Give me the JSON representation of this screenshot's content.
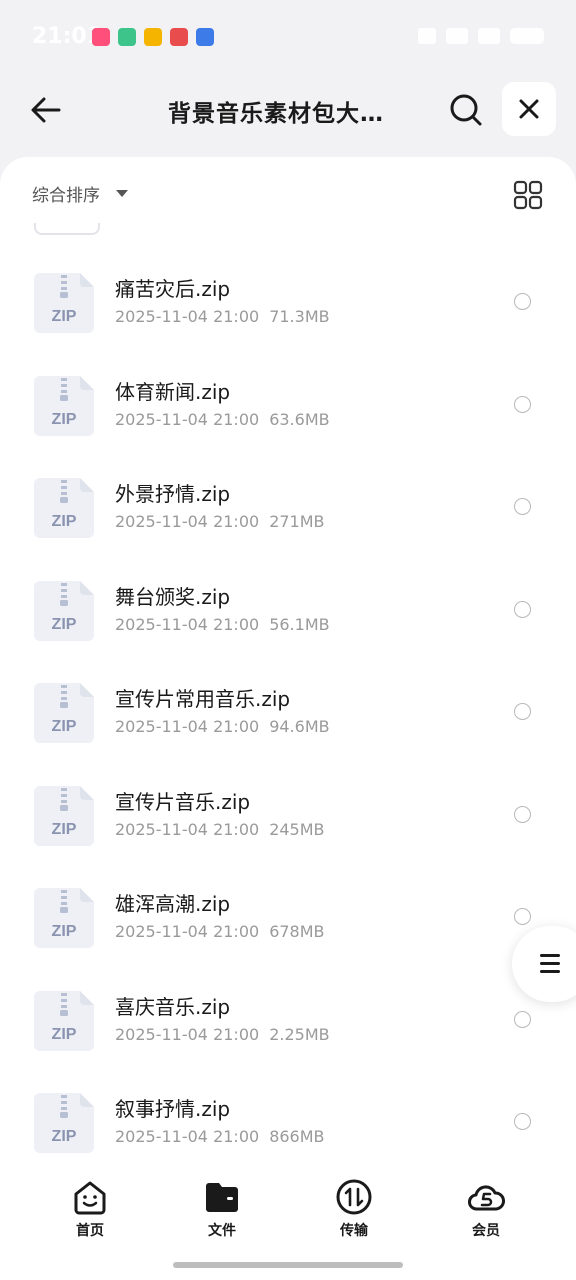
{
  "status_bar": {
    "time": "21:01"
  },
  "header": {
    "title": "背景音乐素材包大…"
  },
  "sort": {
    "label": "综合排序"
  },
  "files": [
    {
      "name": "痛苦灾后.zip",
      "date": "2025-11-04 21:00",
      "size": "71.3MB",
      "icon_text": "ZIP"
    },
    {
      "name": "体育新闻.zip",
      "date": "2025-11-04 21:00",
      "size": "63.6MB",
      "icon_text": "ZIP"
    },
    {
      "name": "外景抒情.zip",
      "date": "2025-11-04 21:00",
      "size": "271MB",
      "icon_text": "ZIP"
    },
    {
      "name": "舞台颁奖.zip",
      "date": "2025-11-04 21:00",
      "size": "56.1MB",
      "icon_text": "ZIP"
    },
    {
      "name": "宣传片常用音乐.zip",
      "date": "2025-11-04 21:00",
      "size": "94.6MB",
      "icon_text": "ZIP"
    },
    {
      "name": "宣传片音乐.zip",
      "date": "2025-11-04 21:00",
      "size": "245MB",
      "icon_text": "ZIP"
    },
    {
      "name": "雄浑高潮.zip",
      "date": "2025-11-04 21:00",
      "size": "678MB",
      "icon_text": "ZIP"
    },
    {
      "name": "喜庆音乐.zip",
      "date": "2025-11-04 21:00",
      "size": "2.25MB",
      "icon_text": "ZIP"
    },
    {
      "name": "叙事抒情.zip",
      "date": "2025-11-04 21:00",
      "size": "866MB",
      "icon_text": "ZIP"
    }
  ],
  "nav": {
    "home": "首页",
    "files": "文件",
    "transfer": "传输",
    "vip": "会员"
  },
  "colors": {
    "background": "#f2f2f4",
    "card": "#ffffff",
    "zip_icon_bg": "#eef0f6",
    "zip_icon_text": "#8a94b0",
    "meta_text": "#9a9a9a"
  }
}
